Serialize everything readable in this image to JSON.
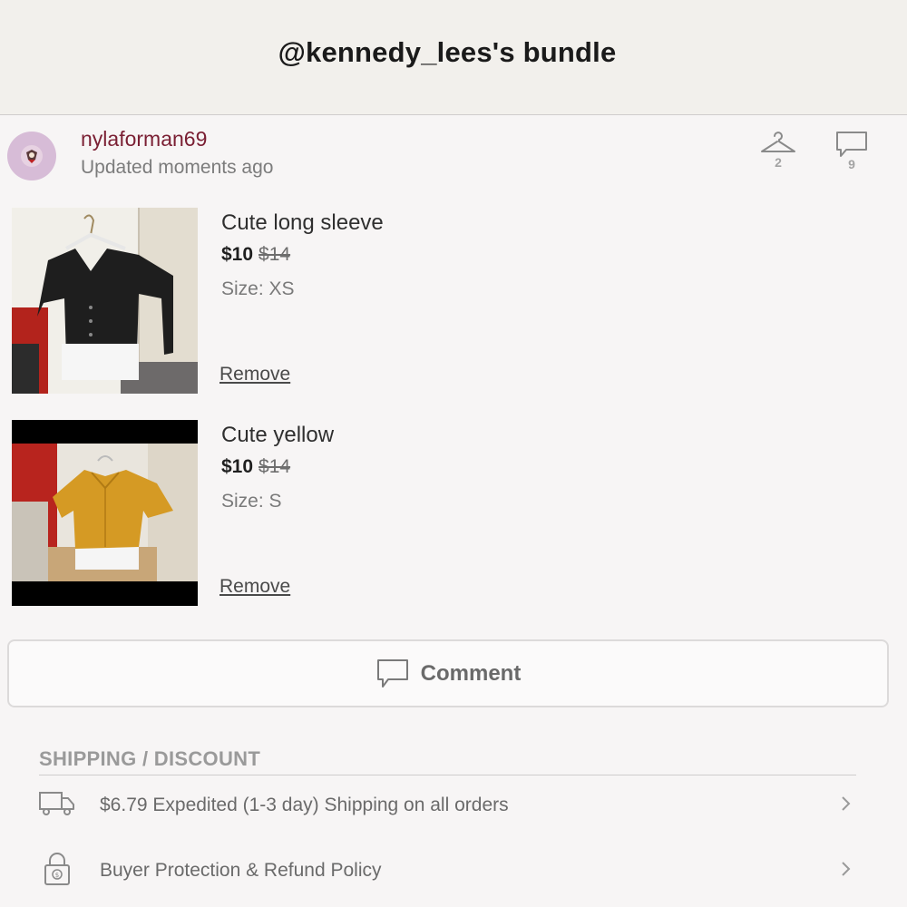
{
  "header": {
    "title": "@kennedy_lees's bundle"
  },
  "seller": {
    "username": "nylaforman69",
    "updated": "Updated moments ago",
    "likes_count": "2",
    "comments_count": "9"
  },
  "items": [
    {
      "title": "Cute long sleeve",
      "price": "$10",
      "original_price": "$14",
      "size": "Size: XS",
      "remove_label": "Remove"
    },
    {
      "title": "Cute yellow",
      "price": "$10",
      "original_price": "$14",
      "size": "Size: S",
      "remove_label": "Remove"
    }
  ],
  "comment_button": {
    "label": "Comment"
  },
  "shipping_section": {
    "title": "SHIPPING / DISCOUNT",
    "rows": [
      {
        "text": "$6.79 Expedited (1-3 day) Shipping on all orders",
        "icon": "truck-icon"
      },
      {
        "text": "Buyer Protection & Refund Policy",
        "icon": "lock-icon"
      }
    ]
  },
  "colors": {
    "username": "#7a1f33",
    "header_bg": "#f2f0ec",
    "page_bg": "#f7f5f5"
  }
}
